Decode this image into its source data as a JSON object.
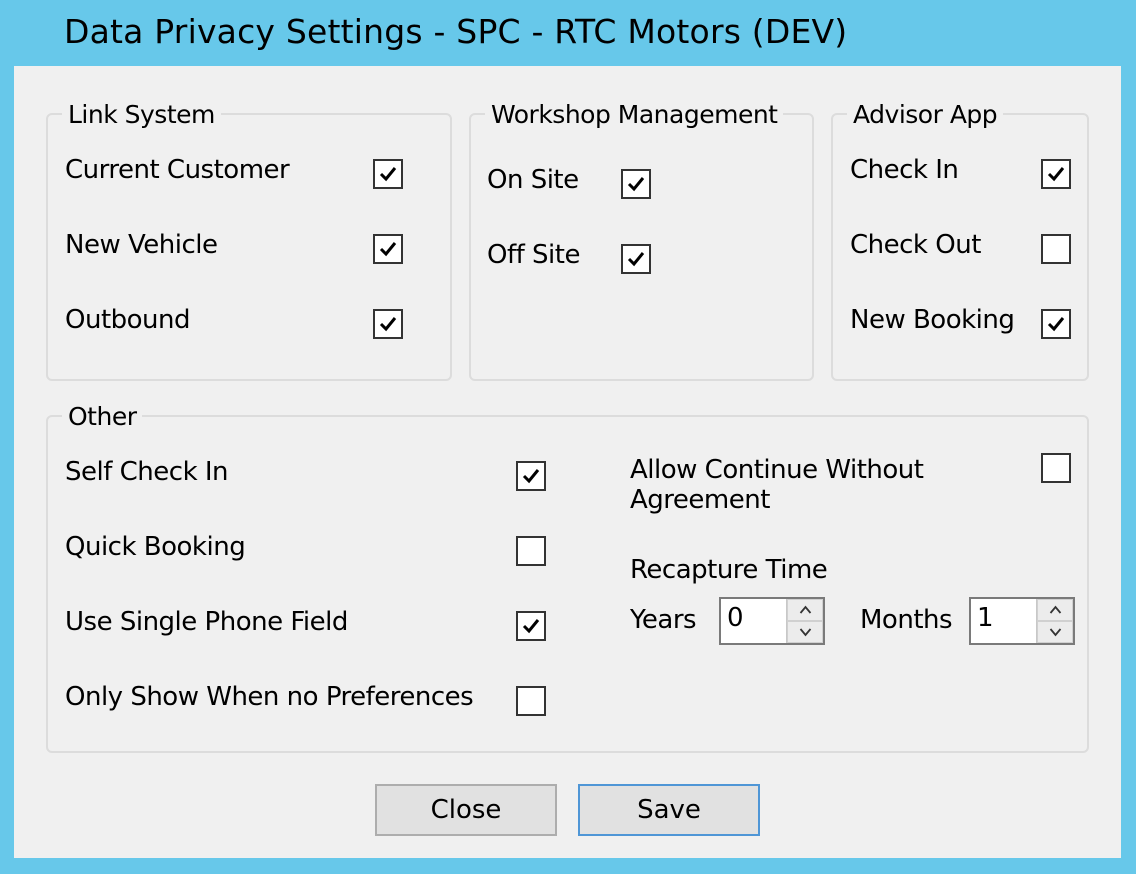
{
  "window": {
    "title": "Data Privacy Settings - SPC - RTC Motors (DEV)"
  },
  "link_system": {
    "legend": "Link System",
    "items": [
      {
        "label": "Current Customer",
        "checked": true
      },
      {
        "label": "New Vehicle",
        "checked": true
      },
      {
        "label": "Outbound",
        "checked": true
      }
    ]
  },
  "workshop": {
    "legend": "Workshop Management",
    "items": [
      {
        "label": "On Site",
        "checked": true
      },
      {
        "label": "Off Site",
        "checked": true
      }
    ]
  },
  "advisor": {
    "legend": "Advisor App",
    "items": [
      {
        "label": "Check In",
        "checked": true
      },
      {
        "label": "Check Out",
        "checked": false
      },
      {
        "label": "New Booking",
        "checked": true
      }
    ]
  },
  "other": {
    "legend": "Other",
    "items": [
      {
        "label": "Self Check In",
        "checked": true
      },
      {
        "label": "Quick Booking",
        "checked": false
      },
      {
        "label": "Use Single Phone Field",
        "checked": true
      },
      {
        "label": "Only Show When no Preferences",
        "checked": false
      }
    ],
    "allow_continue": {
      "label_line1": "Allow Continue Without",
      "label_line2": "Agreement",
      "checked": false
    },
    "recapture": {
      "label": "Recapture Time",
      "years_label": "Years",
      "years_value": "0",
      "months_label": "Months",
      "months_value": "1"
    }
  },
  "buttons": {
    "close": "Close",
    "save": "Save"
  },
  "icons": {
    "checkmark": "check-icon",
    "spin_up": "chevron-up-icon",
    "spin_down": "chevron-down-icon"
  }
}
